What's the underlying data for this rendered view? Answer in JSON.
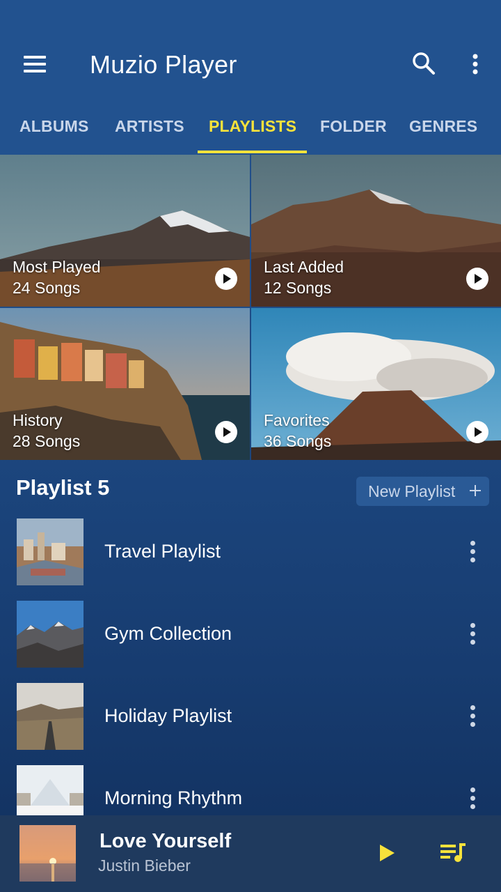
{
  "app": {
    "title": "Muzio Player"
  },
  "tabs": [
    {
      "label": "ALBUMS",
      "active": false
    },
    {
      "label": "ARTISTS",
      "active": false
    },
    {
      "label": "PLAYLISTS",
      "active": true
    },
    {
      "label": "FOLDER",
      "active": false
    },
    {
      "label": "GENRES",
      "active": false
    }
  ],
  "smart_playlists": [
    {
      "name": "Most Played",
      "count": "24 Songs"
    },
    {
      "name": "Last Added",
      "count": "12 Songs"
    },
    {
      "name": "History",
      "count": "28 Songs"
    },
    {
      "name": "Favorites",
      "count": "36 Songs"
    }
  ],
  "playlists_section": {
    "title": "Playlist 5",
    "new_button_label": "New Playlist",
    "items": [
      {
        "label": "Travel Playlist"
      },
      {
        "label": "Gym Collection"
      },
      {
        "label": "Holiday Playlist"
      },
      {
        "label": "Morning Rhythm"
      }
    ]
  },
  "now_playing": {
    "title": "Love Yourself",
    "artist": "Justin Bieber"
  },
  "colors": {
    "background": "#22528f",
    "accent": "#f7e23b",
    "player_bar": "#1f3a5e"
  },
  "icons": {
    "menu": "menu-icon",
    "search": "search-icon",
    "more": "more-vert-icon",
    "play": "play-icon",
    "queue": "queue-music-icon",
    "add": "plus-icon"
  }
}
